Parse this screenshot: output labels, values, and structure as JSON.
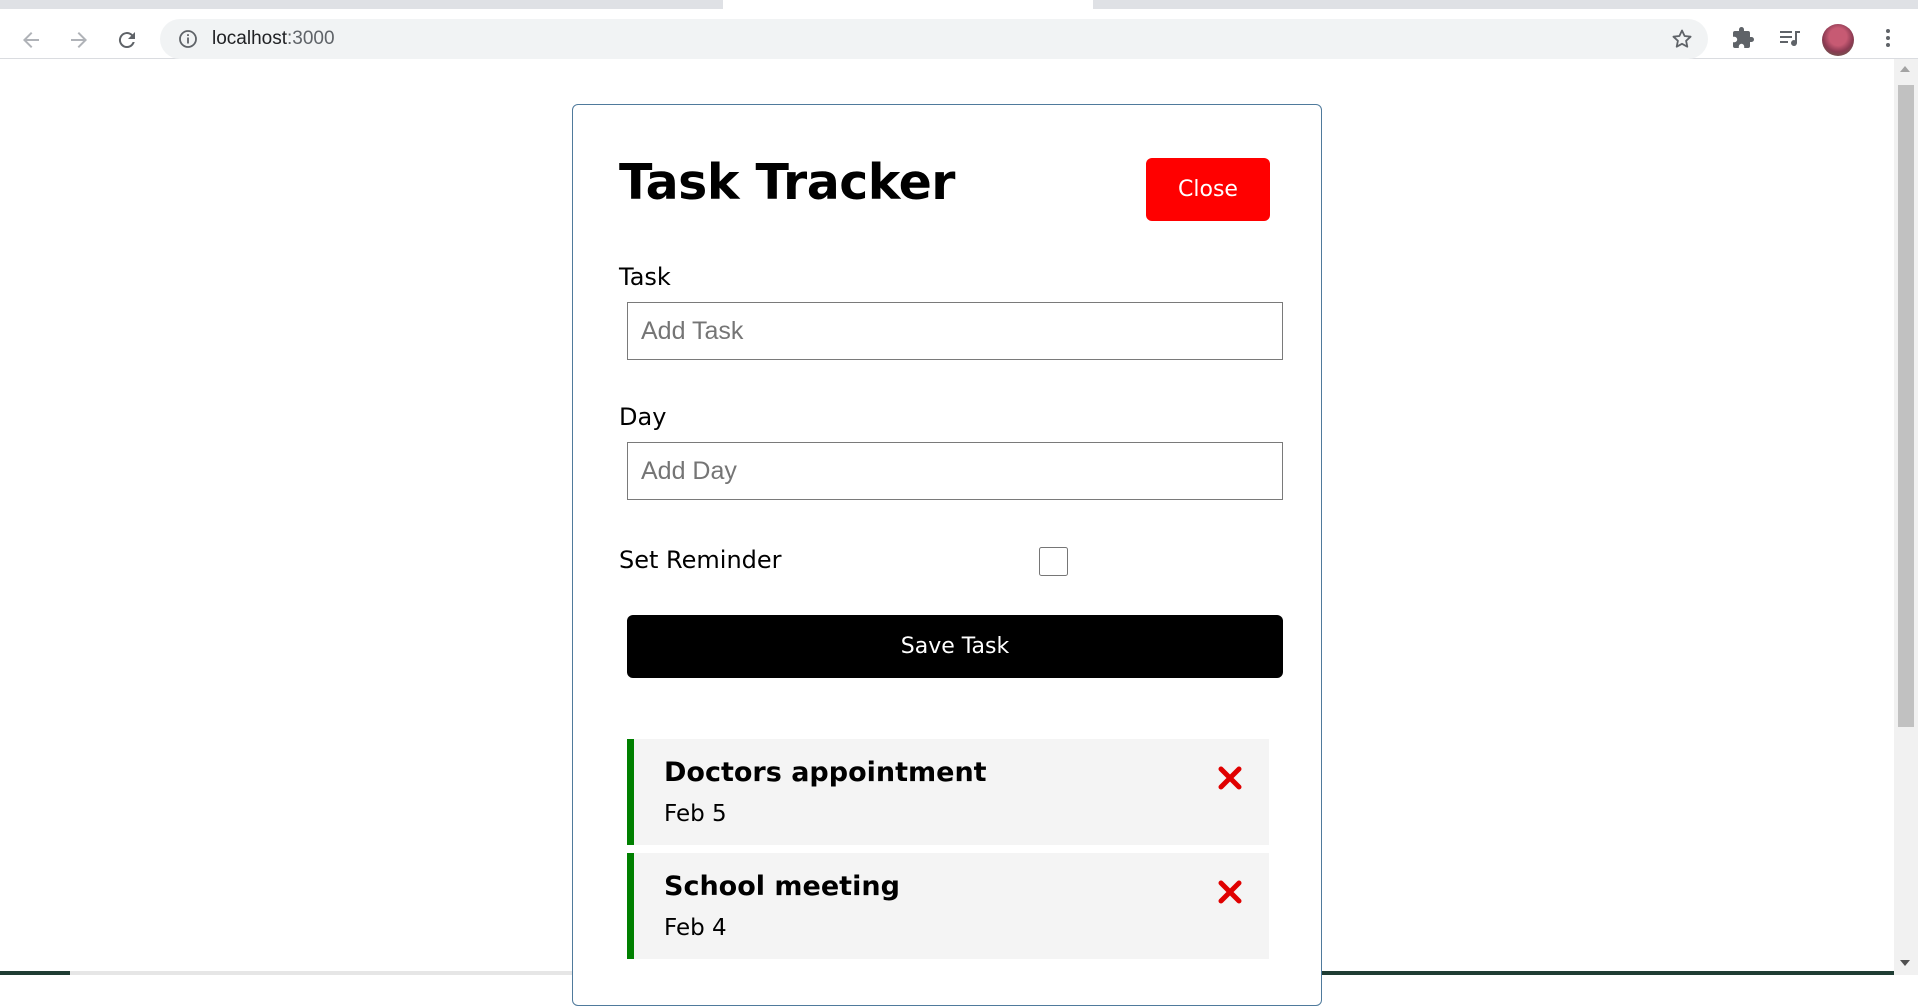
{
  "browser": {
    "url_host": "localhost",
    "url_port": ":3000",
    "icons": [
      "back-arrow-icon",
      "forward-arrow-icon",
      "reload-icon",
      "info-icon",
      "star-icon",
      "extensions-icon",
      "media-queue-icon",
      "kebab-menu-icon"
    ]
  },
  "app": {
    "title": "Task Tracker",
    "close_label": "Close",
    "close_color": "#ff0000"
  },
  "form": {
    "task_label": "Task",
    "task_placeholder": "Add Task",
    "task_value": "",
    "day_label": "Day",
    "day_placeholder": "Add Day",
    "day_value": "",
    "reminder_label": "Set Reminder",
    "reminder_checked": false,
    "save_label": "Save Task"
  },
  "tasks": [
    {
      "text": "Doctors appointment",
      "day": "Feb 5",
      "reminder": true
    },
    {
      "text": "School meeting",
      "day": "Feb 4",
      "reminder": true
    }
  ],
  "colors": {
    "reminder_border": "#008000",
    "delete_icon": "#e00000",
    "save_button": "#000000"
  }
}
